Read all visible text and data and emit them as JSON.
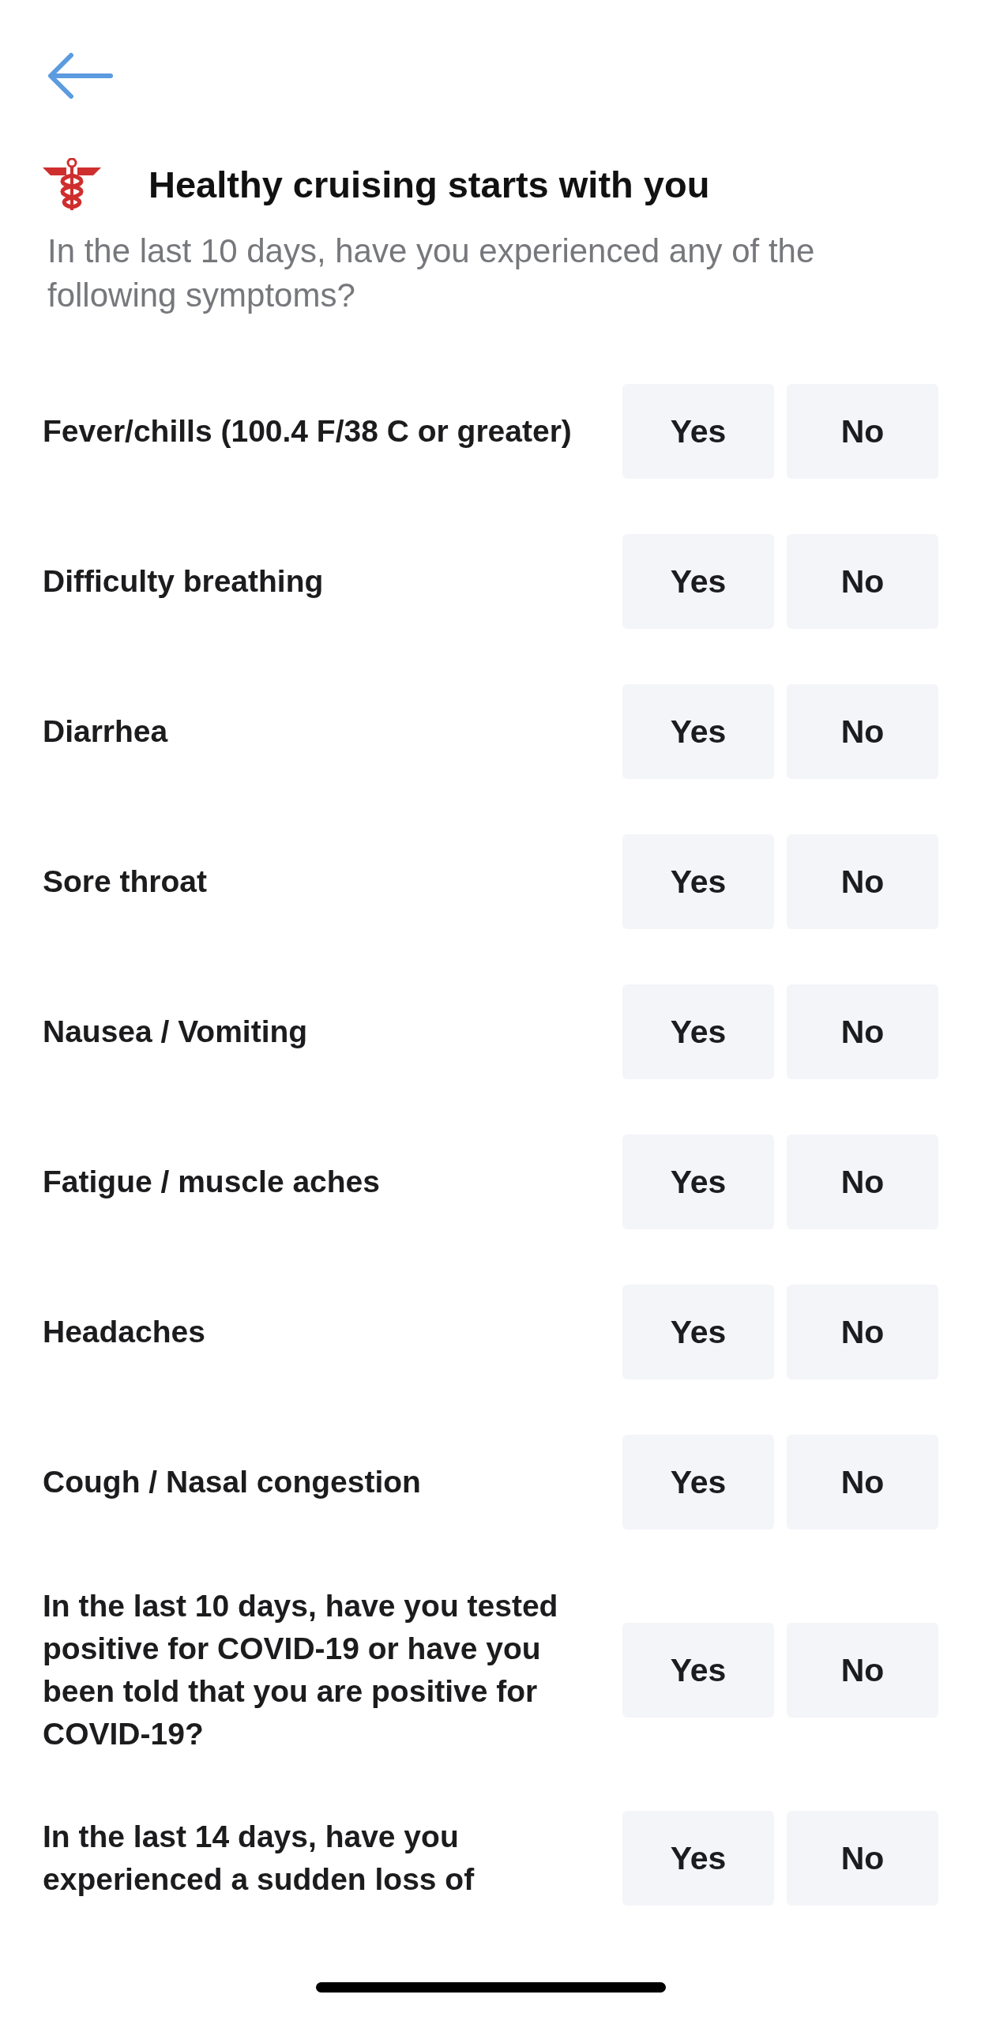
{
  "header": {
    "title": "Healthy cruising starts with you",
    "subtitle": "In the last 10 days, have you experienced any of the following symptoms?"
  },
  "questions": [
    {
      "text": "Fever/chills (100.4 F/38 C or greater)",
      "answers": [
        {
          "label": "Yes",
          "selected": false
        },
        {
          "label": "No",
          "selected": false
        }
      ]
    },
    {
      "text": "Difficulty breathing",
      "answers": [
        {
          "label": "Yes",
          "selected": false
        },
        {
          "label": "No",
          "selected": false
        }
      ]
    },
    {
      "text": "Diarrhea",
      "answers": [
        {
          "label": "Yes",
          "selected": false
        },
        {
          "label": "No",
          "selected": false
        }
      ]
    },
    {
      "text": "Sore throat",
      "answers": [
        {
          "label": "Yes",
          "selected": false
        },
        {
          "label": "No",
          "selected": false
        }
      ]
    },
    {
      "text": "Nausea / Vomiting",
      "answers": [
        {
          "label": "Yes",
          "selected": false
        },
        {
          "label": "No",
          "selected": false
        }
      ]
    },
    {
      "text": "Fatigue / muscle aches",
      "answers": [
        {
          "label": "Yes",
          "selected": false
        },
        {
          "label": "No",
          "selected": false
        }
      ]
    },
    {
      "text": "Headaches",
      "answers": [
        {
          "label": "Yes",
          "selected": false
        },
        {
          "label": "No",
          "selected": false
        }
      ]
    },
    {
      "text": "Cough / Nasal congestion",
      "answers": [
        {
          "label": "Yes",
          "selected": false
        },
        {
          "label": "No",
          "selected": false
        }
      ]
    },
    {
      "text": "In the last 10 days, have you tested positive for COVID-19 or have you been told that you are positive for COVID-19?",
      "answers": [
        {
          "label": "Yes",
          "selected": false
        },
        {
          "label": "No",
          "selected": false
        }
      ]
    },
    {
      "text": "In the last 14 days, have you experienced a sudden loss of",
      "answers": [
        {
          "label": "Yes",
          "selected": false
        },
        {
          "label": "No",
          "selected": false
        }
      ]
    }
  ]
}
